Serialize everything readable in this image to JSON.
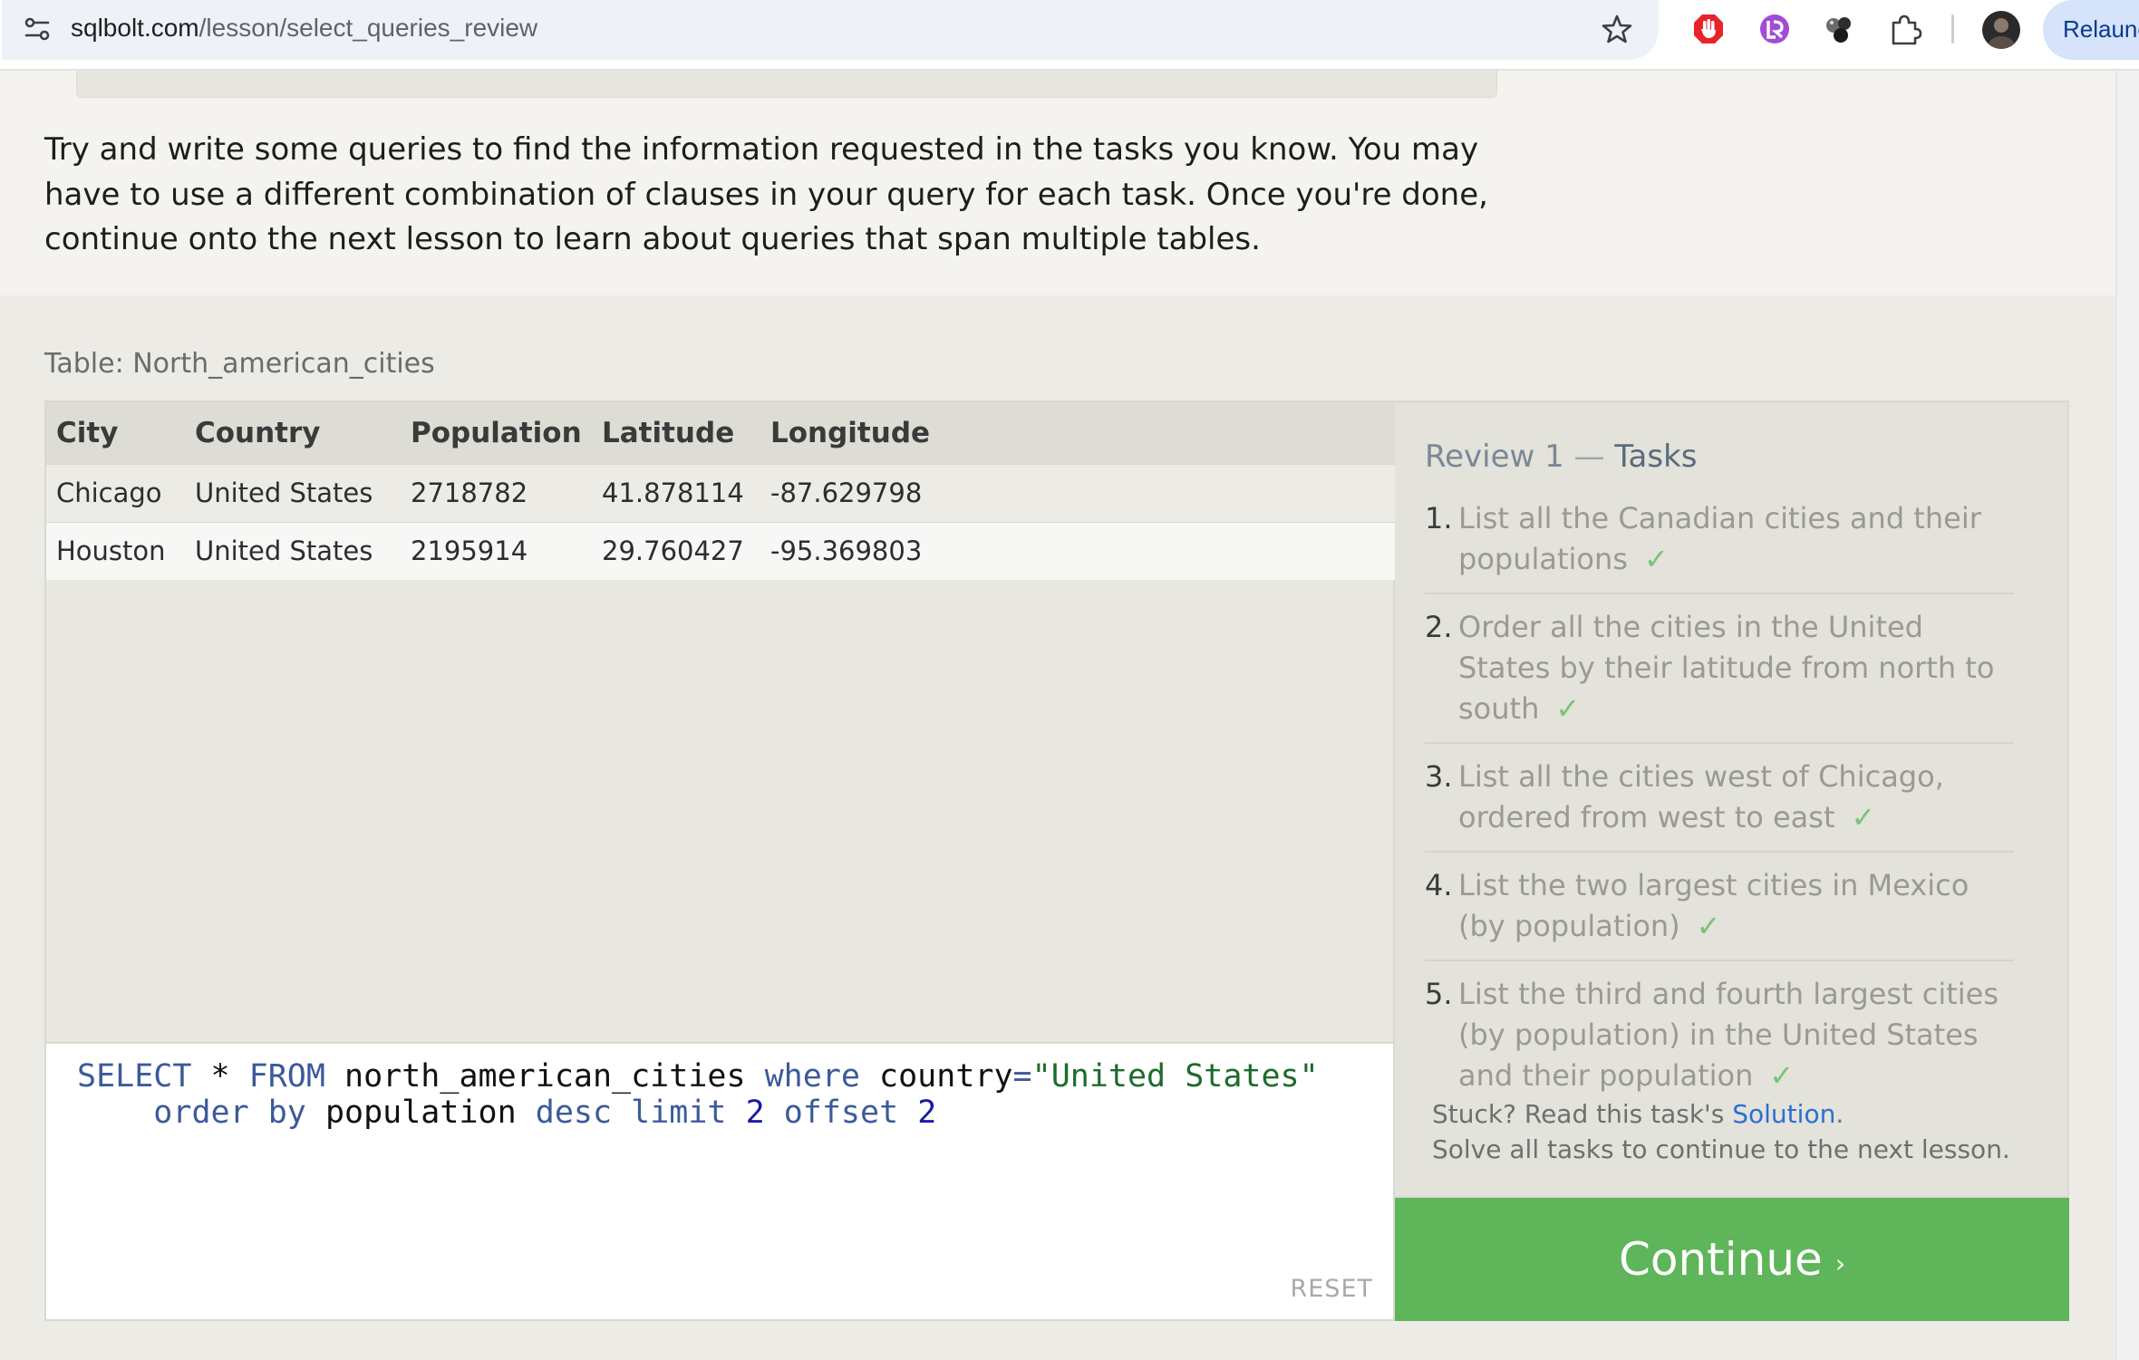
{
  "browser": {
    "url_host": "sqlbolt.com",
    "url_path": "/lesson/select_queries_review",
    "relaunch_label": "Relaunch"
  },
  "intro_text": "Try and write some queries to find the information requested in the tasks you know. You may have to use a different combination of clauses in your query for each task. Once you're done, continue onto the next lesson to learn about queries that span multiple tables.",
  "table": {
    "caption": "Table: North_american_cities",
    "columns": [
      "City",
      "Country",
      "Population",
      "Latitude",
      "Longitude"
    ],
    "rows": [
      [
        "Chicago",
        "United States",
        "2718782",
        "41.878114",
        "-87.629798"
      ],
      [
        "Houston",
        "United States",
        "2195914",
        "29.760427",
        "-95.369803"
      ]
    ]
  },
  "editor": {
    "line1": {
      "kw1": "SELECT",
      "star": " * ",
      "kw2": "FROM",
      "t1": " north_american_cities ",
      "kw3": "where",
      "t2": " country",
      "eq": "=",
      "str": "\"United States\""
    },
    "line2": {
      "indent": "    ",
      "kw1": "order by",
      "t1": " population ",
      "kw2": "desc",
      "sp1": " ",
      "kw3": "limit",
      "sp2": " ",
      "n1": "2",
      "sp3": " ",
      "kw4": "offset",
      "sp4": " ",
      "n2": "2"
    },
    "reset_label": "RESET"
  },
  "tasks": {
    "title_prefix": "Review 1",
    "title_dash": " — ",
    "title_suffix": "Tasks",
    "items": [
      {
        "num": "1.",
        "text": "List all the Canadian cities and their populations",
        "check": "✓"
      },
      {
        "num": "2.",
        "text": "Order all the cities in the United States by their latitude from north to south",
        "check": "✓"
      },
      {
        "num": "3.",
        "text": "List all the cities west of Chicago, ordered from west to east",
        "check": "✓"
      },
      {
        "num": "4.",
        "text": "List the two largest cities in Mexico (by population)",
        "check": "✓"
      },
      {
        "num": "5.",
        "text": "List the third and fourth largest cities (by population) in the United States and their population",
        "check": "✓"
      }
    ],
    "stuck_prefix": "Stuck? Read this task's ",
    "solution_link": "Solution",
    "stuck_period": ".",
    "solve_all": "Solve all tasks to continue to the next lesson."
  },
  "continue_label": "Continue",
  "continue_arrow": "›",
  "colors": {
    "continue_bg": "#5fb55a",
    "check": "#7cc275",
    "link": "#2b6fd1"
  },
  "icons": [
    "site-settings-icon",
    "bookmark-star-icon",
    "adblock-extension-icon",
    "purple-extension-icon",
    "spheres-extension-icon",
    "extensions-puzzle-icon",
    "profile-avatar"
  ]
}
